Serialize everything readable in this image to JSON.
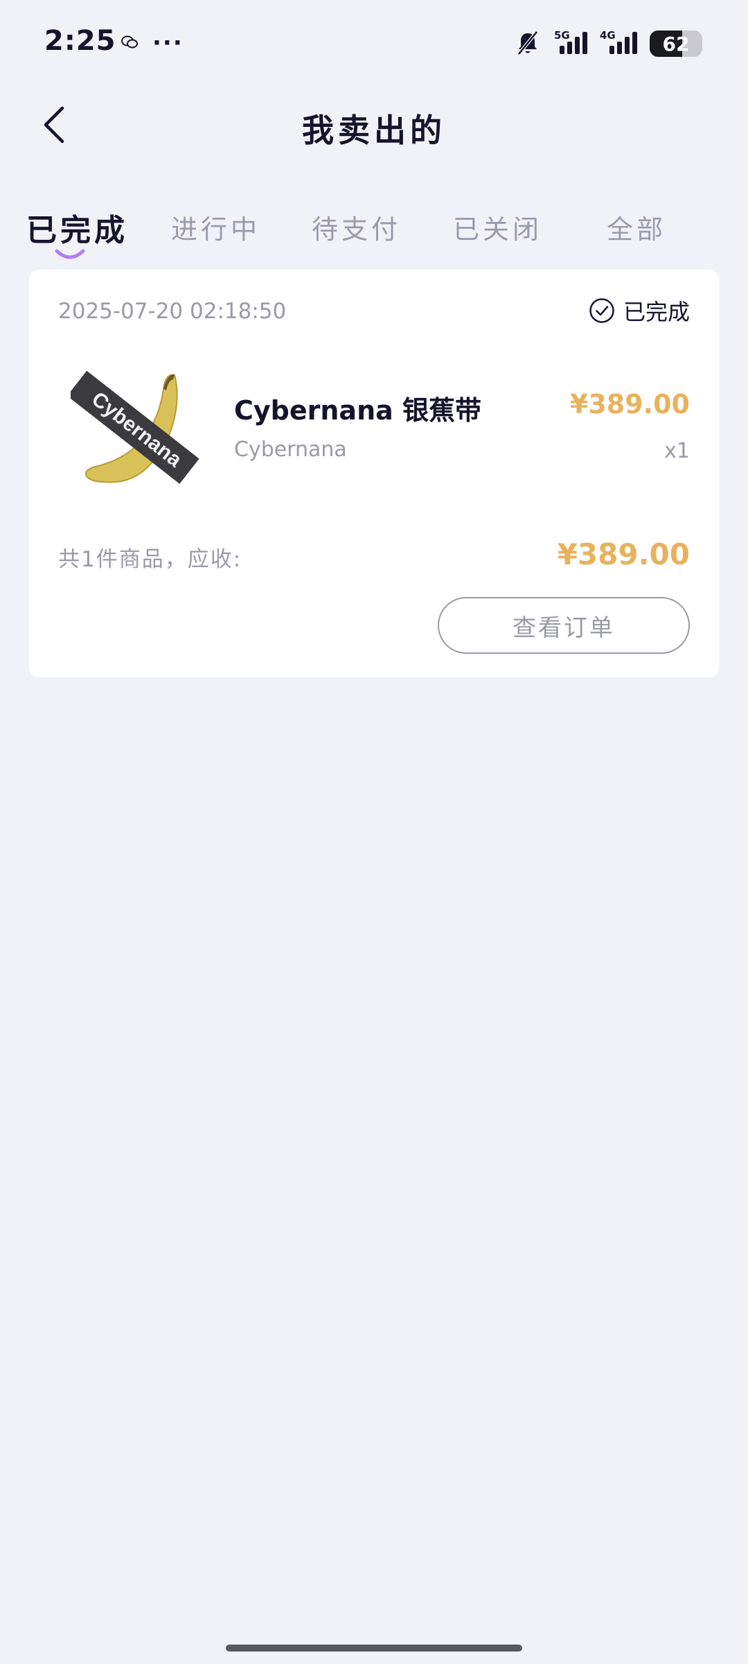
{
  "status_bar": {
    "time": "2:25",
    "more": "···",
    "network_1": "5G",
    "network_2": "4G",
    "battery_percent": 62
  },
  "header": {
    "title": "我卖出的",
    "back_icon": "chevron-left-icon"
  },
  "tabs": [
    {
      "label": "已完成",
      "active": true
    },
    {
      "label": "进行中",
      "active": false
    },
    {
      "label": "待支付",
      "active": false
    },
    {
      "label": "已关闭",
      "active": false
    },
    {
      "label": "全部",
      "active": false
    }
  ],
  "order": {
    "time": "2025-07-20 02:18:50",
    "status": "已完成",
    "status_icon": "check-circle-icon",
    "product": {
      "name": "Cybernana 银蕉带",
      "brand": "Cybernana",
      "price": "¥389.00",
      "quantity": "x1",
      "image_text": "Cybernana"
    },
    "total_label": "共1件商品，应收:",
    "total_amount": "¥389.00",
    "view_button": "查看订单"
  },
  "colors": {
    "background": "#f1f2f7",
    "price": "#e8b25d",
    "tab_indicator": "#b37ef0",
    "muted_text": "#9a9aa6"
  }
}
